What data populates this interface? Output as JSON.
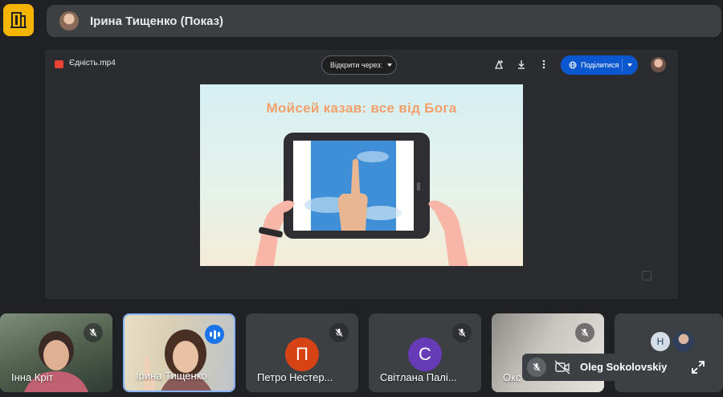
{
  "header": {
    "presenter_title": "Ірина Тищенко (Показ)"
  },
  "viewer": {
    "file_name": "Єдність.mp4",
    "open_with_label": "Відкрити через",
    "share_label": "Поділитися",
    "icons": [
      "add-to-drive-icon",
      "download-icon",
      "more-vert-icon",
      "globe-icon"
    ]
  },
  "slide": {
    "title": "Мойсей казав: все від Бога"
  },
  "participants": [
    {
      "name": "Інна Кріт",
      "mic": "muted",
      "video": true
    },
    {
      "name": "Ірина Тищенко",
      "mic": "speaking",
      "video": true,
      "active": true
    },
    {
      "name": "Петро Нестер...",
      "mic": "muted",
      "initial": "П",
      "avatar_color": "#d84315"
    },
    {
      "name": "Світлана Палі...",
      "mic": "muted",
      "initial": "С",
      "avatar_color": "#673ab7"
    },
    {
      "name": "Окс",
      "mic": "muted",
      "video": true
    }
  ],
  "self_view": {
    "name": "Oleg Sokolovskiy",
    "initial": "Н"
  },
  "colors": {
    "background": "#202124",
    "tile": "#3c4043",
    "share_button": "#0b57d0",
    "app_logo": "#f4b400",
    "active_border": "#8ab4f8"
  }
}
